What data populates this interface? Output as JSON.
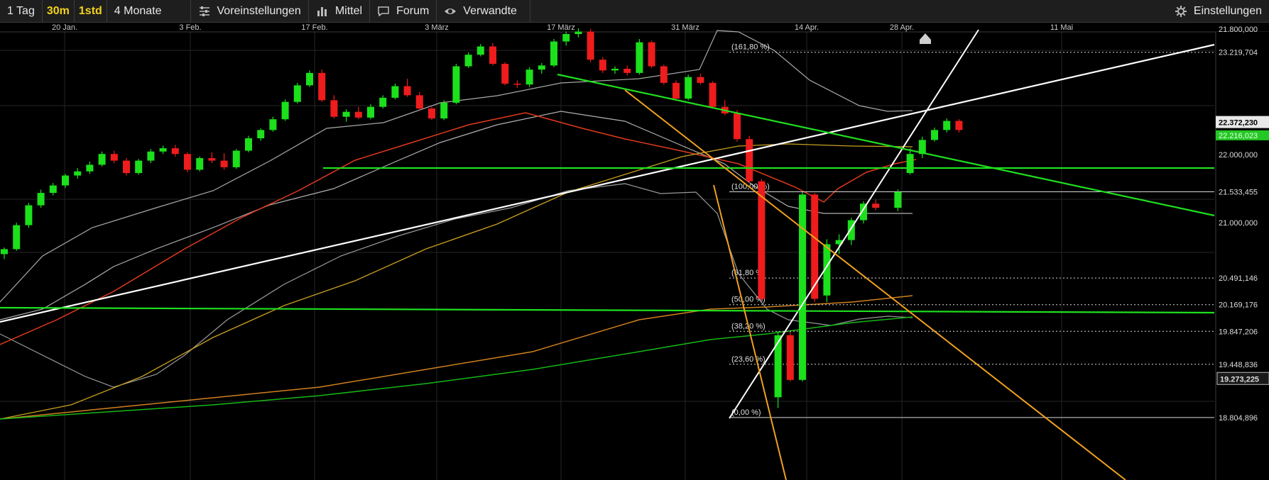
{
  "toolbar": {
    "range": "1 Tag",
    "interval_a": "30m",
    "interval_b": "1std",
    "period": "4 Monate",
    "presets": "Voreinstellungen",
    "indicator": "Mittel",
    "forum": "Forum",
    "related": "Verwandte",
    "settings": "Einstellungen",
    "icons": {
      "presets": "sliders-icon",
      "indicator": "bar-chart-icon",
      "forum": "speech-bubble-icon",
      "related": "eye-icon",
      "settings": "gear-icon"
    }
  },
  "chart_data": {
    "type": "candlestick",
    "x_tick_labels": [
      "20 Jan.",
      "3 Feb.",
      "17 Feb.",
      "3 März",
      "17 März",
      "31 März",
      "14 Apr.",
      "28 Apr.",
      "11 Mai"
    ],
    "y_tick_labels": [
      {
        "value": 21800,
        "label": "21.800,000"
      },
      {
        "value": 22000,
        "label": "22.000,000"
      },
      {
        "value": 21000,
        "label": "21.000,000"
      }
    ],
    "price_labels": [
      {
        "value": 23219.704,
        "label": "23.219,704",
        "highlight": false
      },
      {
        "value": 22372.23,
        "label": "22.372,230",
        "highlight": "current"
      },
      {
        "value": 22216.023,
        "label": "22.216,023",
        "highlight": "green"
      },
      {
        "value": 21533.455,
        "label": "21.533,455",
        "highlight": false
      },
      {
        "value": 20491.146,
        "label": "20.491,146",
        "highlight": false
      },
      {
        "value": 20169.176,
        "label": "20.169,176",
        "highlight": false
      },
      {
        "value": 19847.206,
        "label": "19.847,206",
        "highlight": false
      },
      {
        "value": 19448.836,
        "label": "19.448,836",
        "highlight": false
      },
      {
        "value": 19273.225,
        "label": "19.273,225",
        "highlight": "box"
      },
      {
        "value": 18804.896,
        "label": "18.804,896",
        "highlight": false
      }
    ],
    "fibonacci_levels": [
      {
        "label": "(161,80 %)",
        "value": 23219.704
      },
      {
        "label": "(100,00 %)",
        "value": 21533.455
      },
      {
        "label": "(61,80 %)",
        "value": 20491.146
      },
      {
        "label": "(50,00 %)",
        "value": 20169.176
      },
      {
        "label": "(38,20 %)",
        "value": 19847.206
      },
      {
        "label": "(23,60 %)",
        "value": 19448.836
      },
      {
        "label": "(0,00 %)",
        "value": 18804.896
      }
    ],
    "candles": [
      [
        20780,
        20860,
        20720,
        20840
      ],
      [
        20840,
        21160,
        20820,
        21130
      ],
      [
        21130,
        21400,
        21100,
        21370
      ],
      [
        21370,
        21560,
        21340,
        21520
      ],
      [
        21520,
        21640,
        21490,
        21610
      ],
      [
        21610,
        21750,
        21580,
        21730
      ],
      [
        21730,
        21820,
        21690,
        21780
      ],
      [
        21780,
        21900,
        21750,
        21860
      ],
      [
        21860,
        22020,
        21840,
        21990
      ],
      [
        21990,
        22030,
        21880,
        21910
      ],
      [
        21910,
        21940,
        21730,
        21760
      ],
      [
        21760,
        21930,
        21740,
        21910
      ],
      [
        21910,
        22050,
        21880,
        22020
      ],
      [
        22020,
        22090,
        21990,
        22060
      ],
      [
        22060,
        22100,
        21960,
        21990
      ],
      [
        21990,
        22010,
        21770,
        21800
      ],
      [
        21800,
        21960,
        21780,
        21940
      ],
      [
        21940,
        22010,
        21880,
        21910
      ],
      [
        21910,
        22000,
        21800,
        21830
      ],
      [
        21830,
        22050,
        21810,
        22030
      ],
      [
        22030,
        22210,
        22010,
        22180
      ],
      [
        22180,
        22300,
        22150,
        22280
      ],
      [
        22280,
        22440,
        22260,
        22410
      ],
      [
        22410,
        22650,
        22390,
        22620
      ],
      [
        22620,
        22850,
        22600,
        22820
      ],
      [
        22820,
        23000,
        22800,
        22970
      ],
      [
        22970,
        23010,
        22620,
        22640
      ],
      [
        22640,
        22700,
        22420,
        22440
      ],
      [
        22440,
        22530,
        22380,
        22500
      ],
      [
        22500,
        22560,
        22410,
        22430
      ],
      [
        22430,
        22590,
        22410,
        22560
      ],
      [
        22560,
        22700,
        22540,
        22670
      ],
      [
        22670,
        22840,
        22650,
        22810
      ],
      [
        22810,
        22900,
        22680,
        22700
      ],
      [
        22700,
        22740,
        22520,
        22540
      ],
      [
        22540,
        22560,
        22400,
        22420
      ],
      [
        22420,
        22640,
        22400,
        22610
      ],
      [
        22610,
        23080,
        22590,
        23050
      ],
      [
        23050,
        23220,
        23030,
        23190
      ],
      [
        23190,
        23320,
        23170,
        23290
      ],
      [
        23290,
        23330,
        23060,
        23080
      ],
      [
        23080,
        23100,
        22820,
        22840
      ],
      [
        22840,
        22880,
        22790,
        22830
      ],
      [
        22830,
        23040,
        22800,
        23010
      ],
      [
        23010,
        23090,
        22960,
        23060
      ],
      [
        23060,
        23380,
        23040,
        23350
      ],
      [
        23350,
        23470,
        23300,
        23440
      ],
      [
        23440,
        23510,
        23400,
        23470
      ],
      [
        23470,
        23500,
        23100,
        23130
      ],
      [
        23130,
        23160,
        22970,
        23000
      ],
      [
        23000,
        23050,
        22960,
        23020
      ],
      [
        23020,
        23060,
        22940,
        22970
      ],
      [
        22970,
        23380,
        22950,
        23340
      ],
      [
        23340,
        23360,
        23030,
        23050
      ],
      [
        23050,
        23070,
        22830,
        22850
      ],
      [
        22850,
        22880,
        22640,
        22660
      ],
      [
        22660,
        22950,
        22640,
        22920
      ],
      [
        22920,
        22960,
        22830,
        22850
      ],
      [
        22850,
        22870,
        22540,
        22560
      ],
      [
        22560,
        22640,
        22460,
        22480
      ],
      [
        22480,
        22520,
        22140,
        22170
      ],
      [
        22170,
        22210,
        21640,
        21660
      ],
      [
        21660,
        21690,
        20220,
        20240
      ],
      [
        19050,
        19850,
        18920,
        19800
      ],
      [
        19800,
        19840,
        19240,
        19260
      ],
      [
        19260,
        21530,
        19240,
        21500
      ],
      [
        21500,
        21520,
        20200,
        20240
      ],
      [
        20280,
        20960,
        20200,
        20900
      ],
      [
        20900,
        21020,
        20780,
        20950
      ],
      [
        20950,
        21220,
        20890,
        21190
      ],
      [
        21190,
        21420,
        21150,
        21390
      ],
      [
        21390,
        21440,
        21310,
        21340
      ],
      [
        21340,
        21560,
        21300,
        21530
      ],
      [
        21760,
        22060,
        21740,
        21990
      ],
      [
        21990,
        22200,
        21940,
        22160
      ],
      [
        22160,
        22310,
        22140,
        22280
      ],
      [
        22280,
        22420,
        22250,
        22390
      ],
      [
        22390,
        22410,
        22250,
        22280
      ]
    ],
    "indicators": [
      "Bollinger bands",
      "moving averages",
      "trend lines",
      "Fibonacci retracement"
    ],
    "grid": true
  }
}
